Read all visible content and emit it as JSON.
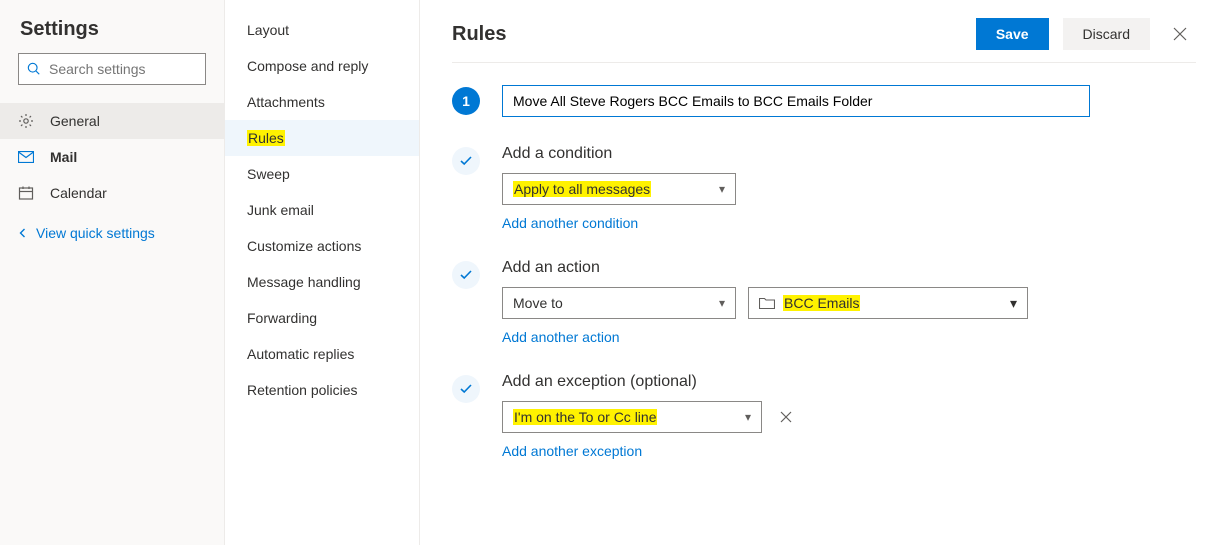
{
  "settings": {
    "title": "Settings",
    "search_placeholder": "Search settings",
    "nav": {
      "general": "General",
      "mail": "Mail",
      "calendar": "Calendar"
    },
    "quick_link": "View quick settings"
  },
  "subnav": {
    "items": [
      "Layout",
      "Compose and reply",
      "Attachments",
      "Rules",
      "Sweep",
      "Junk email",
      "Customize actions",
      "Message handling",
      "Forwarding",
      "Automatic replies",
      "Retention policies"
    ],
    "selected_index": 3
  },
  "main": {
    "title": "Rules",
    "save_label": "Save",
    "discard_label": "Discard",
    "step_number": "1",
    "rule_name_value": "Move All Steve Rogers BCC Emails to BCC Emails Folder",
    "condition": {
      "label": "Add a condition",
      "value": "Apply to all messages",
      "add_another": "Add another condition"
    },
    "action": {
      "label": "Add an action",
      "value": "Move to",
      "folder": "BCC Emails",
      "add_another": "Add another action"
    },
    "exception": {
      "label": "Add an exception (optional)",
      "value": "I'm on the To or Cc line",
      "add_another": "Add another exception"
    }
  }
}
